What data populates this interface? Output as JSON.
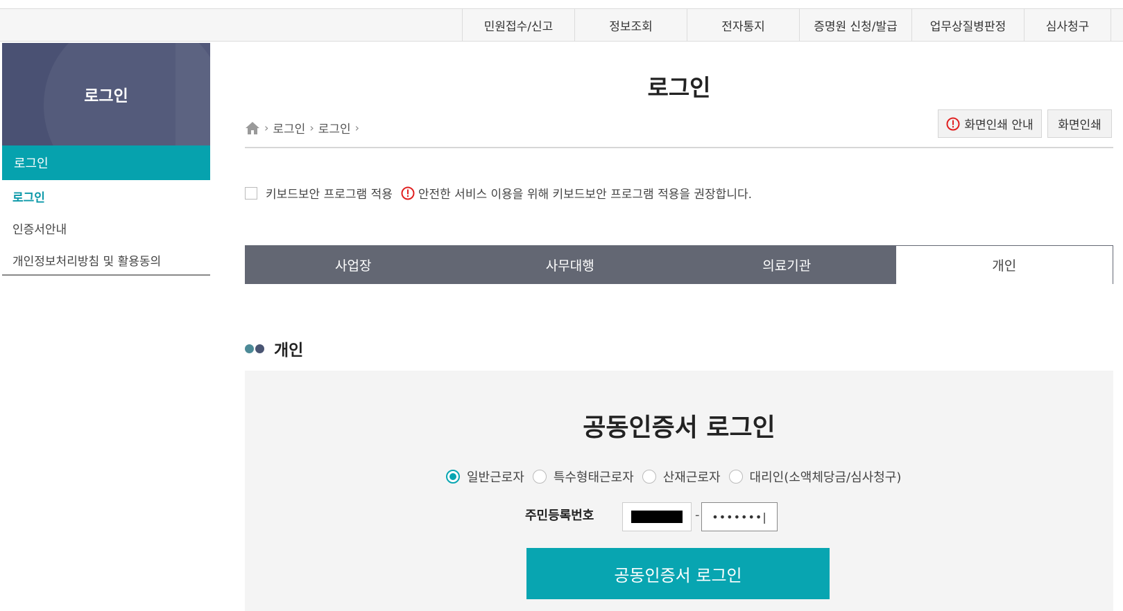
{
  "top_nav": [
    {
      "label": "민원접수/신고",
      "width": 162
    },
    {
      "label": "정보조회",
      "width": 162
    },
    {
      "label": "전자통지",
      "width": 162
    },
    {
      "label": "증명원 신청/발급",
      "width": 162
    },
    {
      "label": "업무상질병판정",
      "width": 162
    },
    {
      "label": "심사청구",
      "width": 126
    }
  ],
  "sidebar": {
    "title": "로그인",
    "active_section": "로그인",
    "items": [
      {
        "label": "로그인",
        "current": true
      },
      {
        "label": "인증서안내",
        "current": false
      },
      {
        "label": "개인정보처리방침 및 활용동의",
        "current": false
      }
    ]
  },
  "main": {
    "title": "로그인",
    "breadcrumb": [
      "로그인",
      "로그인"
    ],
    "print_guide_label": "화면인쇄 안내",
    "print_label": "화면인쇄",
    "keyboard_security_label": "키보드보안 프로그램 적용",
    "keyboard_security_notice": "안전한 서비스 이용을 위해 키보드보안 프로그램 적용을 권장합니다.",
    "tabs": [
      {
        "label": "사업장",
        "active": false
      },
      {
        "label": "사무대행",
        "active": false
      },
      {
        "label": "의료기관",
        "active": false
      },
      {
        "label": "개인",
        "active": true
      }
    ],
    "section_title": "개인",
    "login_box": {
      "title": "공동인증서 로그인",
      "radio_options": [
        {
          "label": "일반근로자",
          "checked": true
        },
        {
          "label": "특수형태근로자",
          "checked": false
        },
        {
          "label": "산재근로자",
          "checked": false
        },
        {
          "label": "대리인(소액체당금/심사청구)",
          "checked": false
        }
      ],
      "id_label": "주민등록번호",
      "id_separator": "-",
      "id_back_value": "•••••••|",
      "login_button_label": "공동인증서 로그인"
    }
  },
  "colors": {
    "accent": "#08a5b1",
    "sidebar_header": "#4a5173",
    "tab_inactive": "#636773",
    "alert": "#e02020"
  }
}
